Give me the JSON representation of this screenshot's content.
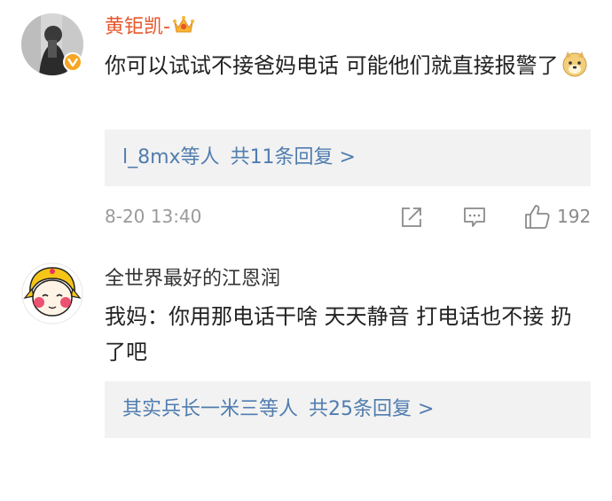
{
  "comments": [
    {
      "user": "黄钜凯-",
      "text": "你可以试试不接爸妈电话 可能他们就直接报警了",
      "reply_users": "l_8mx等人",
      "reply_count": "共11条回复 >",
      "timestamp": "8-20 13:40",
      "likes": "192",
      "icons": [
        "avatar-photo",
        "verified-v-badge",
        "vip-crown-icon",
        "doge-emoji",
        "share-icon",
        "comment-icon",
        "thumbs-up-icon"
      ]
    },
    {
      "user": "全世界最好的江恩润",
      "text": "我妈：你用那电话干啥 天天静音 打电话也不接 扔了吧",
      "reply_users": "其实兵长一米三等人",
      "reply_count": "共25条回复 >",
      "icons": [
        "cartoon-girl-avatar"
      ]
    }
  ],
  "colors": {
    "vip_name": "#e8562a",
    "link_blue": "#507daf",
    "reply_bg": "#f2f2f2",
    "meta_gray": "#9a9a9a"
  }
}
